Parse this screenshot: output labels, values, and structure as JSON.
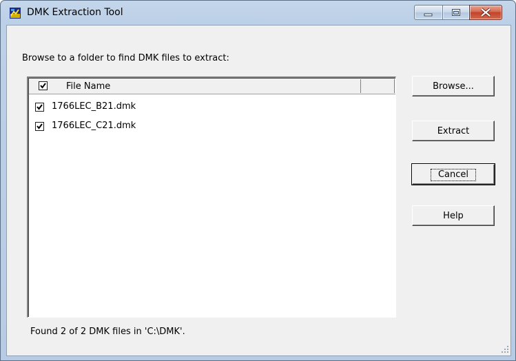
{
  "window": {
    "title": "DMK Extraction Tool",
    "icon": "dmk-app-icon"
  },
  "prompt": "Browse to a folder to find DMK files to extract:",
  "list": {
    "header": {
      "checked": true,
      "column_label": "File Name"
    },
    "rows": [
      {
        "checked": true,
        "name": "1766LEC_B21.dmk"
      },
      {
        "checked": true,
        "name": "1766LEC_C21.dmk"
      }
    ]
  },
  "buttons": {
    "browse": "Browse...",
    "extract": "Extract",
    "cancel": "Cancel",
    "help": "Help"
  },
  "status": "Found 2 of 2 DMK files in 'C:\\DMK'.",
  "colors": {
    "client_bg": "#f0f0f0",
    "close_button": "#c2432a",
    "frame": "#bcd0e7"
  }
}
